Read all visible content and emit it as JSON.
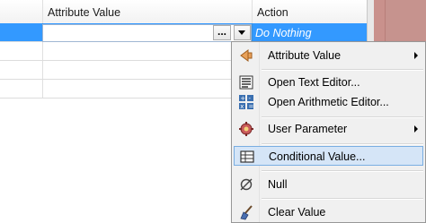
{
  "grid": {
    "columns": [
      {
        "label": ""
      },
      {
        "label": "Attribute Value"
      },
      {
        "label": "Action"
      }
    ],
    "selected_row": {
      "action": "Do Nothing"
    },
    "browse_button": "...",
    "empty_rows": 3
  },
  "menu": {
    "items": [
      {
        "label": "Attribute Value",
        "icon": "attribute-value-icon",
        "submenu": true
      },
      {
        "label": "Open Text Editor...",
        "icon": "text-editor-icon",
        "submenu": false
      },
      {
        "label": "Open Arithmetic Editor...",
        "icon": "arithmetic-editor-icon",
        "submenu": false
      },
      {
        "label": "User Parameter",
        "icon": "user-parameter-icon",
        "submenu": true
      },
      {
        "label": "Conditional Value...",
        "icon": "conditional-value-icon",
        "submenu": false,
        "highlighted": true
      },
      {
        "label": "Null",
        "icon": "null-icon",
        "submenu": false
      },
      {
        "label": "Clear Value",
        "icon": "clear-value-icon",
        "submenu": false
      }
    ]
  }
}
